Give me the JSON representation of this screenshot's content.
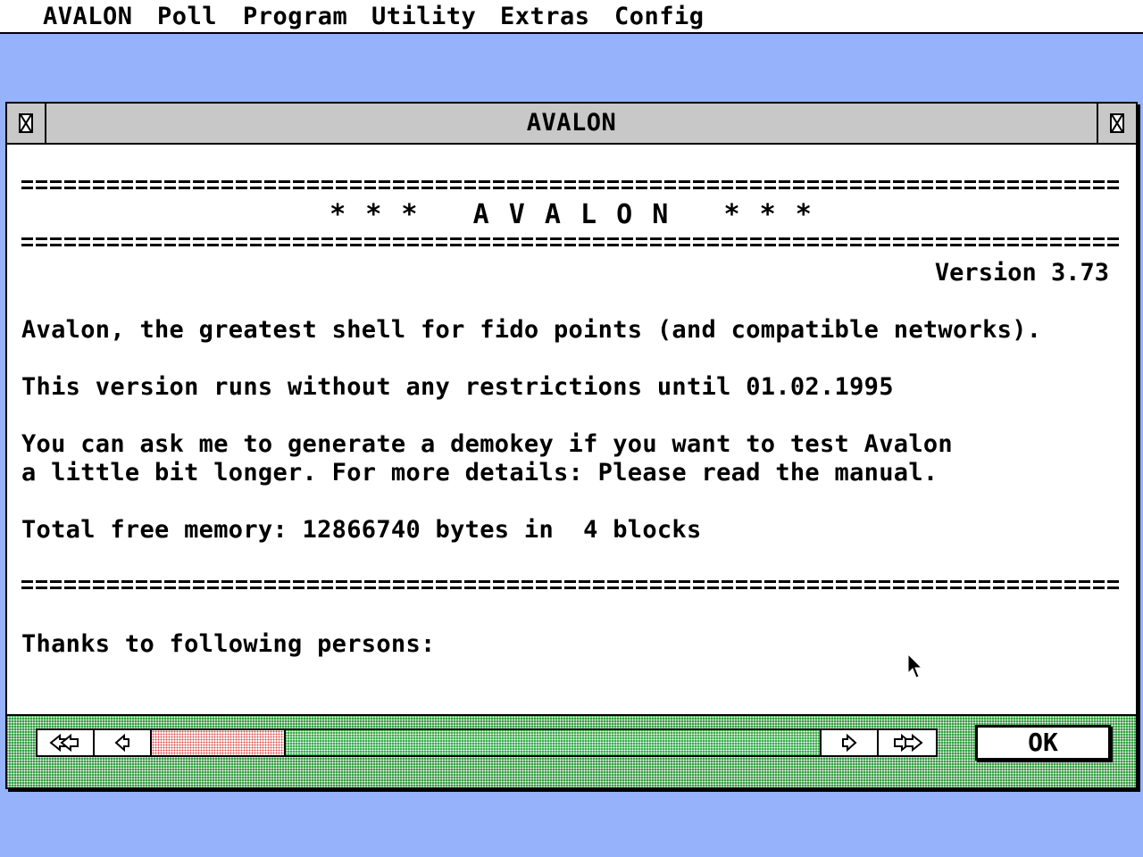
{
  "menubar": {
    "items": [
      {
        "label": "AVALON"
      },
      {
        "label": "Poll"
      },
      {
        "label": "Program"
      },
      {
        "label": "Utility"
      },
      {
        "label": "Extras"
      },
      {
        "label": "Config"
      }
    ]
  },
  "window": {
    "title": "AVALON",
    "close_icon": "close-box-icon",
    "fuller_icon": "fuller-box-icon",
    "content": {
      "banner_rule": "===============================================================================",
      "banner_title": "* * *   A V A L O N   * * *",
      "version": "Version 3.73",
      "line_description": "Avalon, the greatest shell for fido points (and compatible networks).",
      "line_restrictions": "This version runs without any restrictions until 01.02.1995",
      "line_demokey_1": "You can ask me to generate a demokey if you want to test Avalon",
      "line_demokey_2": "a little bit longer. For more details: Please read the manual.",
      "line_memory": "Total free memory: 12866740 bytes in  4 blocks",
      "line_thanks": "Thanks to following persons:"
    },
    "scrollbar": {
      "page_left_icon": "double-arrow-left-icon",
      "left_icon": "arrow-left-icon",
      "right_icon": "arrow-right-icon",
      "page_right_icon": "double-arrow-right-icon",
      "thumb_position": 0,
      "thumb_fraction": 0.2
    },
    "ok_label": "OK"
  },
  "colors": {
    "desktop": "#95b2fb",
    "scroll_bar_fill": "#2f9a3c",
    "scroll_thumb_fill": "#e04848"
  }
}
